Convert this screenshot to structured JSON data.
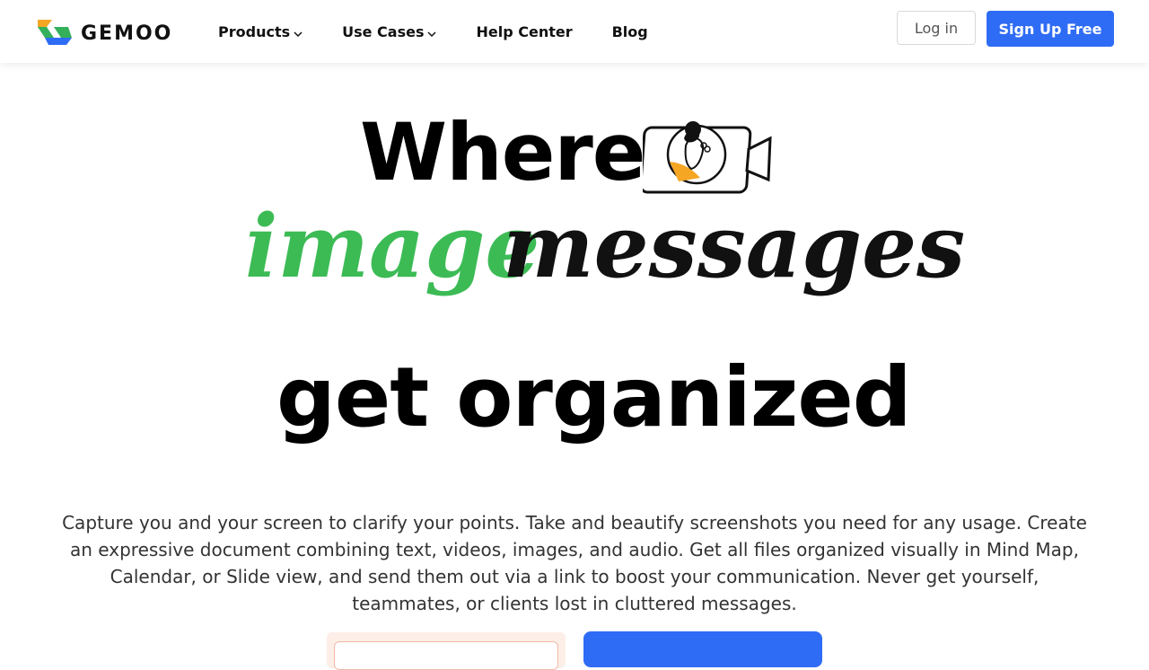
{
  "header": {
    "brand": "GEMOO",
    "nav": [
      {
        "label": "Products",
        "has_dropdown": true,
        "icon": "chevron-down-icon"
      },
      {
        "label": "Use Cases",
        "has_dropdown": true,
        "icon": "chevron-down-icon"
      },
      {
        "label": "Help Center",
        "has_dropdown": false
      },
      {
        "label": "Blog",
        "has_dropdown": false
      }
    ],
    "login_label": "Log in",
    "signup_label": "Sign Up Free"
  },
  "hero": {
    "line1": "Where",
    "camera_icon": "camera-portrait-icon",
    "script_green": "image",
    "script_black": "messages",
    "line3": "get organized",
    "description": "Capture you and your screen to clarify your points. Take and beautify screenshots you need for any usage. Create an expressive document combining text, videos, images, and audio. Get all files organized visually in Mind Map, Calendar, or Slide view, and send them out via a link to boost your communication. Never get yourself, teammates, or clients lost in cluttered messages."
  },
  "colors": {
    "accent_blue": "#2f6cf5",
    "script_green": "#3cbb55",
    "logo_orange": "#f5a623",
    "logo_green": "#34b05a",
    "logo_blue": "#2f6cf5"
  }
}
